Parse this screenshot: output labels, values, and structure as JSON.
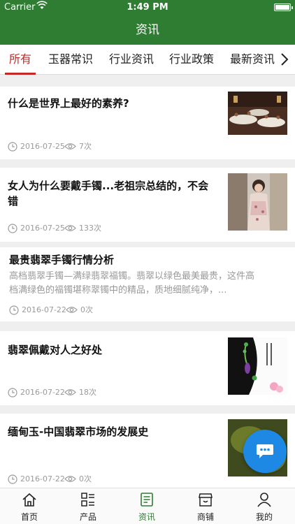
{
  "status_bar": {
    "carrier": "Carrier",
    "time": "1:49 PM"
  },
  "nav": {
    "title": "资讯"
  },
  "tabs": [
    {
      "label": "所有",
      "active": true
    },
    {
      "label": "玉器常识",
      "active": false
    },
    {
      "label": "行业资讯",
      "active": false
    },
    {
      "label": "行业政策",
      "active": false
    },
    {
      "label": "最新资讯",
      "active": false
    }
  ],
  "articles": [
    {
      "title": "什么是世界上最好的素养?",
      "date": "2016-07-25",
      "views": "7次",
      "thumbnail": "banquet-hall-photo"
    },
    {
      "title_line1": "女人为什么要戴手镯...老祖宗总结的，不会",
      "title_line2": "错",
      "date": "2016-07-25",
      "views": "133次",
      "thumbnail": "woman-in-qipao-photo"
    },
    {
      "title": "最贵翡翠手镯行情分析",
      "summary_line1": "高档翡翠手镯—满绿翡翠福镯。翡翠以绿色最美最贵，这件高",
      "summary_line2": "档满绿色的福镯堪称翠镯中的精品，质地细腻纯净，...",
      "date": "2016-07-22",
      "views": "0次"
    },
    {
      "title": "翡翠佩戴对人之好处",
      "date": "2016-07-22",
      "views": "18次",
      "thumbnail": "jade-pendant-photo"
    },
    {
      "title": "缅甸玉-中国翡翠市场的发展史",
      "date": "2016-07-22",
      "views": "0次",
      "thumbnail": "jade-stone-photo"
    }
  ],
  "tabbar": [
    {
      "label": "首页",
      "icon": "home-icon",
      "active": false
    },
    {
      "label": "产品",
      "icon": "grid-list-icon",
      "active": false
    },
    {
      "label": "资讯",
      "icon": "news-icon",
      "active": true
    },
    {
      "label": "商铺",
      "icon": "store-icon",
      "active": false
    },
    {
      "label": "我的",
      "icon": "user-icon",
      "active": false
    }
  ],
  "colors": {
    "primary": "#2e7d32",
    "tab_active": "#c62828",
    "fab": "#1e88e5",
    "meta_text": "#9a9a9a"
  }
}
